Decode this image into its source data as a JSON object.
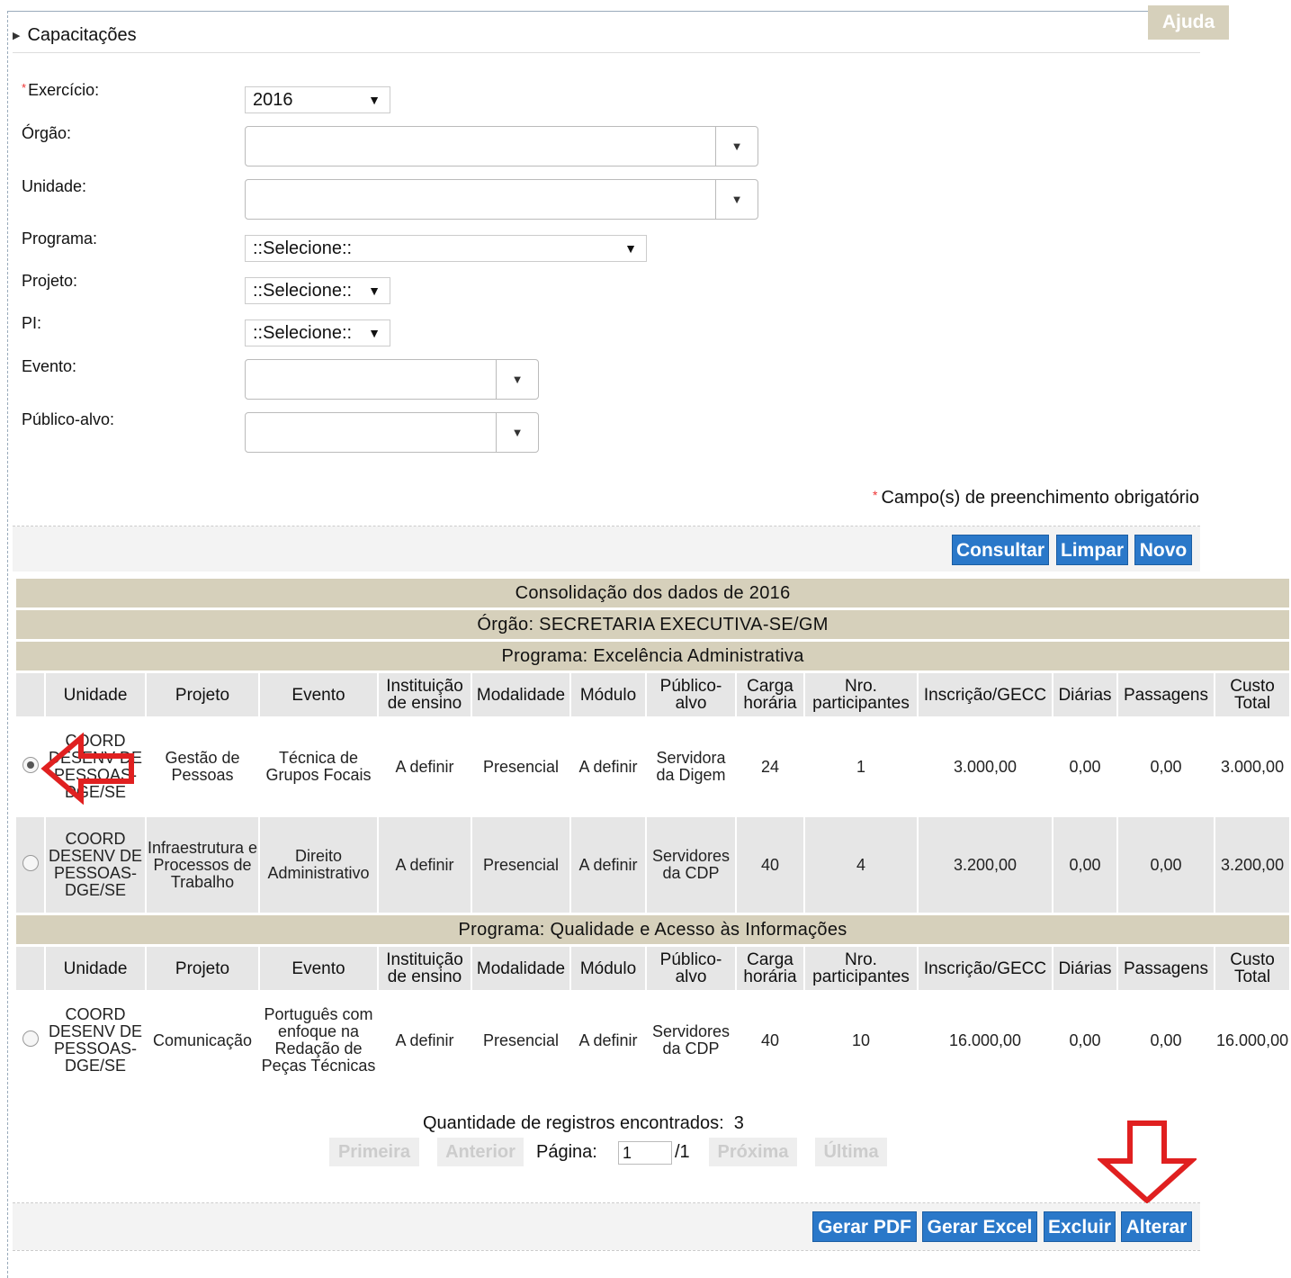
{
  "section_title": "Capacitações",
  "help_label": "Ajuda",
  "form": {
    "exercicio_label": "Exercício:",
    "exercicio_value": "2016",
    "orgao_label": "Órgão:",
    "unidade_label": "Unidade:",
    "programa_label": "Programa:",
    "programa_value": "::Selecione::",
    "projeto_label": "Projeto:",
    "projeto_value": "::Selecione::",
    "pi_label": "PI:",
    "pi_value": "::Selecione::",
    "evento_label": "Evento:",
    "publico_label": "Público-alvo:",
    "required_note": "Campo(s) de preenchimento obrigatório"
  },
  "actions": {
    "consultar": "Consultar",
    "limpar": "Limpar",
    "novo": "Novo"
  },
  "report": {
    "title": "Consolidação dos dados de 2016",
    "orgao": "Órgão: SECRETARIA EXECUTIVA-SE/GM",
    "columns": [
      "Unidade",
      "Projeto",
      "Evento",
      "Instituição de ensino",
      "Modalidade",
      "Módulo",
      "Público-alvo",
      "Carga horária",
      "Nro. participantes",
      "Inscrição/GECC",
      "Diárias",
      "Passagens",
      "Custo Total"
    ],
    "programs": [
      {
        "title": "Programa: Excelência Administrativa",
        "rows": [
          {
            "selected": true,
            "unidade": "COORD DESENV DE PESSOAS-DGE/SE",
            "projeto": "Gestão de Pessoas",
            "evento": "Técnica de Grupos Focais",
            "instituicao": "A definir",
            "modalidade": "Presencial",
            "modulo": "A definir",
            "publico": "Servidora da Digem",
            "carga": "24",
            "participantes": "1",
            "inscricao": "3.000,00",
            "diarias": "0,00",
            "passagens": "0,00",
            "custo": "3.000,00"
          },
          {
            "selected": false,
            "unidade": "COORD DESENV DE PESSOAS-DGE/SE",
            "projeto": "Infraestrutura e Processos de Trabalho",
            "evento": "Direito Administrativo",
            "instituicao": "A definir",
            "modalidade": "Presencial",
            "modulo": "A definir",
            "publico": "Servidores da CDP",
            "carga": "40",
            "participantes": "4",
            "inscricao": "3.200,00",
            "diarias": "0,00",
            "passagens": "0,00",
            "custo": "3.200,00"
          }
        ]
      },
      {
        "title": "Programa: Qualidade e Acesso às Informações",
        "rows": [
          {
            "selected": false,
            "unidade": "COORD DESENV DE PESSOAS-DGE/SE",
            "projeto": "Comunicação",
            "evento": "Português com enfoque na Redação de Peças Técnicas",
            "instituicao": "A definir",
            "modalidade": "Presencial",
            "modulo": "A definir",
            "publico": "Servidores da CDP",
            "carga": "40",
            "participantes": "10",
            "inscricao": "16.000,00",
            "diarias": "0,00",
            "passagens": "0,00",
            "custo": "16.000,00"
          }
        ]
      }
    ]
  },
  "pagination": {
    "records_label": "Quantidade de registros encontrados:",
    "records_count": "3",
    "first": "Primeira",
    "previous": "Anterior",
    "page_label": "Página:",
    "page_value": "1",
    "page_total": "/1",
    "next": "Próxima",
    "last": "Última"
  },
  "bottom_actions": {
    "pdf": "Gerar PDF",
    "excel": "Gerar Excel",
    "excluir": "Excluir",
    "alterar": "Alterar"
  },
  "colors": {
    "band": "#d6d0bb",
    "button": "#2a78c9",
    "annotation_arrow": "#e02020"
  }
}
